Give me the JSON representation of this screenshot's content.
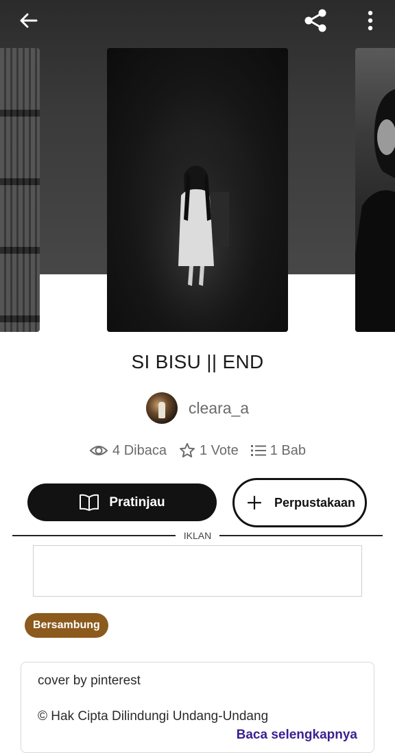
{
  "header": {
    "back_icon": "arrow-left-icon",
    "share_icon": "share-icon",
    "more_icon": "more-vertical-icon"
  },
  "story": {
    "title": "SI BISU || END",
    "author": "cleara_a"
  },
  "stats": {
    "reads": "4 Dibaca",
    "votes": "1 Vote",
    "parts": "1 Bab"
  },
  "actions": {
    "preview_label": "Pratinjau",
    "library_label": "Perpustakaan"
  },
  "ad": {
    "label": "IKLAN"
  },
  "status": {
    "badge": "Bersambung",
    "badge_color": "#8b5a1c"
  },
  "description": {
    "line1": "cover by pinterest",
    "line2": "© Hak Cipta Dilindungi Undang-Undang",
    "read_more": "Baca selengkapnya"
  },
  "colors": {
    "primary_button": "#121212",
    "link": "#3b1f8f"
  }
}
